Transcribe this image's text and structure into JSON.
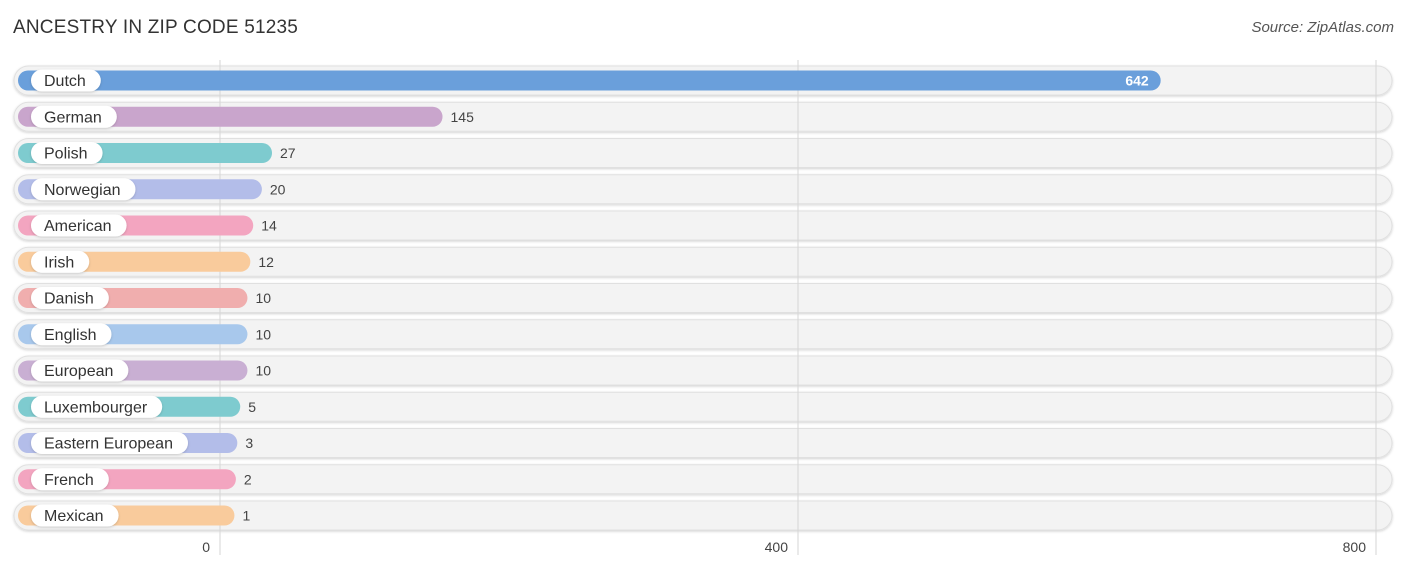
{
  "header": {
    "title": "ANCESTRY IN ZIP CODE 51235",
    "source": "Source: ZipAtlas.com"
  },
  "chart_data": {
    "type": "bar",
    "orientation": "horizontal",
    "title": "ANCESTRY IN ZIP CODE 51235",
    "xlabel": "",
    "ylabel": "",
    "xlim": [
      0,
      800
    ],
    "xticks": [
      0,
      400,
      800
    ],
    "grid": true,
    "categories": [
      "Dutch",
      "German",
      "Polish",
      "Norwegian",
      "American",
      "Irish",
      "Danish",
      "English",
      "European",
      "Luxembourger",
      "Eastern European",
      "French",
      "Mexican"
    ],
    "values": [
      642,
      145,
      27,
      20,
      14,
      12,
      10,
      10,
      10,
      5,
      3,
      2,
      1
    ],
    "colors": [
      "#6a9fdb",
      "#c9a5cc",
      "#7ecbcf",
      "#b3bde9",
      "#f3a5c0",
      "#f9cb9c",
      "#f0aeae",
      "#a8c8ec",
      "#c9afd3",
      "#7ecbcf",
      "#b3bde9",
      "#f3a5c0",
      "#f9cb9c"
    ]
  }
}
